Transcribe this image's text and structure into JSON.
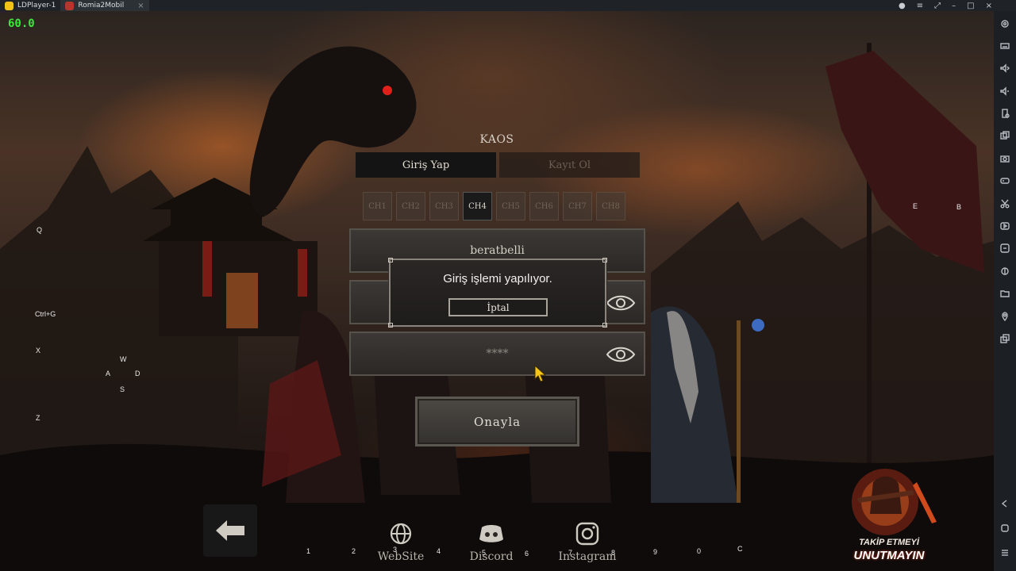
{
  "window": {
    "tabs": [
      {
        "label": "LDPlayer-1"
      },
      {
        "label": "Romia2Mobil"
      }
    ]
  },
  "overlay": {
    "fps": "60.0",
    "keys": [
      "Q",
      "Ctrl+G",
      "X",
      "W",
      "A",
      "D",
      "S",
      "Z",
      "E",
      "B",
      "1",
      "2",
      "3",
      "4",
      "5",
      "6",
      "7",
      "8",
      "9",
      "0",
      "C"
    ]
  },
  "login": {
    "server_title": "KAOS",
    "tabs": [
      "Giriş Yap",
      "Kayıt Ol"
    ],
    "active_tab": "Giriş Yap",
    "channels": [
      "CH1",
      "CH2",
      "CH3",
      "CH4",
      "CH5",
      "CH6",
      "CH7",
      "CH8"
    ],
    "active_channel": "CH4",
    "username_value": "beratbelli",
    "password_value": "****",
    "confirm_label": "Onayla"
  },
  "dialog": {
    "message": "Giriş işlemi yapılıyor.",
    "cancel_label": "İptal"
  },
  "bottom_links": {
    "website": "WebSite",
    "discord": "Discord",
    "instagram": "Instagram"
  },
  "promo": {
    "line1": "TAKİP ETMEYİ",
    "line2": "UNUTMAYIN"
  },
  "colors": {
    "fps_green": "#3ce83c",
    "titlebar": "#1f2327",
    "sidebar": "#1c1f23"
  }
}
